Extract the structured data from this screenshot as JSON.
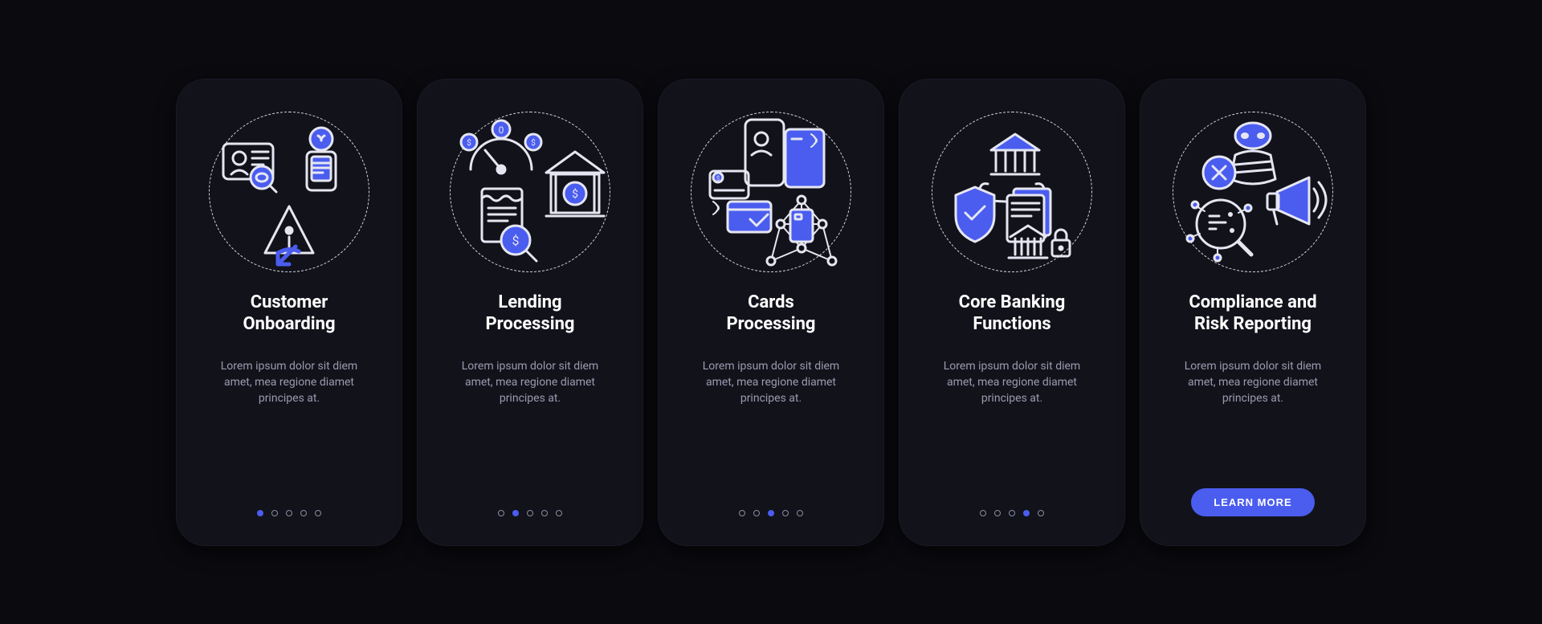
{
  "colors": {
    "accent": "#4a5def",
    "stroke": "#e6e6f2",
    "fill": "#4a5def"
  },
  "cards": [
    {
      "icon_name": "customer-onboarding-icon",
      "title": "Customer\nOnboarding",
      "desc": "Lorem ipsum dolor sit diem amet, mea regione diamet principes at.",
      "active_index": 0,
      "button": null
    },
    {
      "icon_name": "lending-processing-icon",
      "title": "Lending\nProcessing",
      "desc": "Lorem ipsum dolor sit diem amet, mea regione diamet principes at.",
      "active_index": 1,
      "button": null
    },
    {
      "icon_name": "cards-processing-icon",
      "title": "Cards\nProcessing",
      "desc": "Lorem ipsum dolor sit diem amet, mea regione diamet principes at.",
      "active_index": 2,
      "button": null
    },
    {
      "icon_name": "core-banking-icon",
      "title": "Core Banking\nFunctions",
      "desc": "Lorem ipsum dolor sit diem amet, mea regione diamet principes at.",
      "active_index": 3,
      "button": null
    },
    {
      "icon_name": "compliance-risk-icon",
      "title": "Compliance and\nRisk Reporting",
      "desc": "Lorem ipsum dolor sit diem amet, mea regione diamet principes at.",
      "active_index": 4,
      "button": "LEARN MORE"
    }
  ],
  "dot_count": 5
}
